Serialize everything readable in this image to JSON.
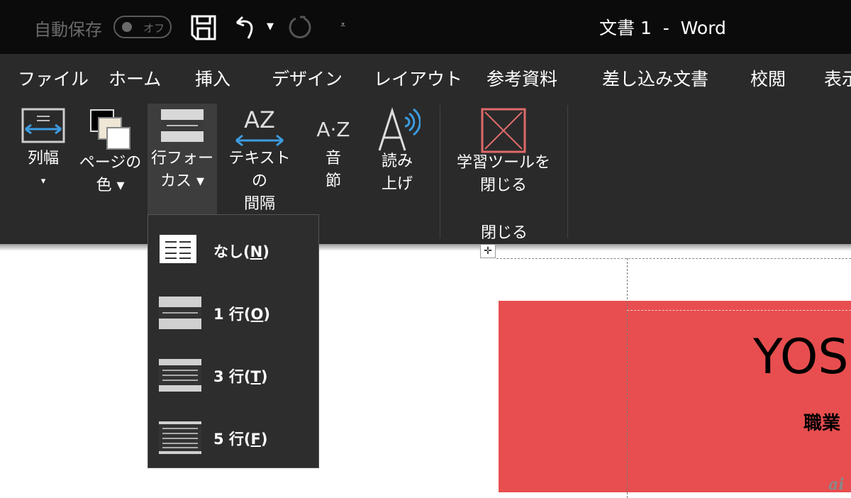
{
  "titlebar": {
    "autosave_label": "自動保存",
    "autosave_state": "オフ",
    "doc_title": "文書 1  -  Word"
  },
  "tabs": [
    "ファイル",
    "ホーム",
    "挿入",
    "デザイン",
    "レイアウト",
    "参考資料",
    "差し込み文書",
    "校閲",
    "表示"
  ],
  "ribbon": {
    "buttons": [
      {
        "line1": "列幅",
        "line2": "▾"
      },
      {
        "line1": "ページの",
        "line2": "色 ▾"
      },
      {
        "line1": "行フォー",
        "line2": "カス ▾"
      },
      {
        "line1": "テキストの",
        "line2": "間隔"
      },
      {
        "line1": "音",
        "line2": "節"
      },
      {
        "line1": "読み",
        "line2": "上げ"
      },
      {
        "line1": "学習ツールを",
        "line2": "閉じる"
      }
    ],
    "group_label": "閉じる"
  },
  "menu": {
    "items": [
      {
        "label": "なし(",
        "key": "N",
        "end": ")"
      },
      {
        "label": "1 行(",
        "key": "O",
        "end": ")"
      },
      {
        "label": "3 行(",
        "key": "T",
        "end": ")"
      },
      {
        "label": "5 行(",
        "key": "F",
        "end": ")"
      }
    ]
  },
  "document": {
    "name": "YOS",
    "job": "職業",
    "accent_color": "#e84e4f"
  },
  "watermark": "ai"
}
